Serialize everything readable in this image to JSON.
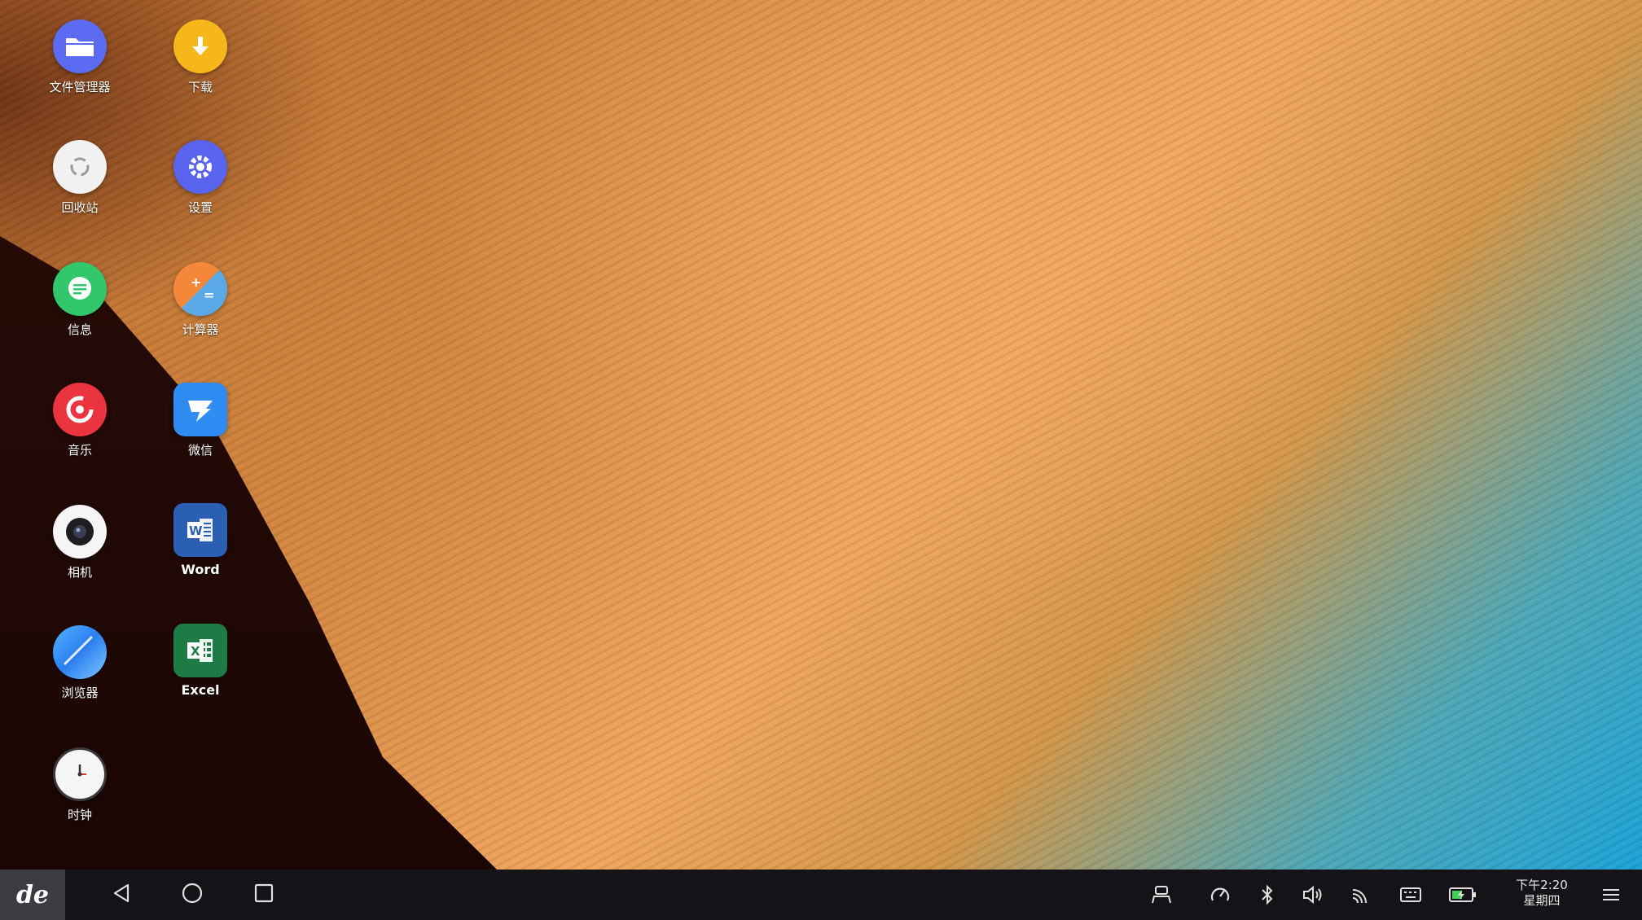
{
  "desktop": {
    "apps": [
      {
        "label": "文件管理器"
      },
      {
        "label": "下载"
      },
      {
        "label": "回收站"
      },
      {
        "label": "设置"
      },
      {
        "label": "信息"
      },
      {
        "label": "计算器"
      },
      {
        "label": "音乐"
      },
      {
        "label": "微信"
      },
      {
        "label": "相机"
      },
      {
        "label": "Word"
      },
      {
        "label": "浏览器"
      },
      {
        "label": "Excel"
      },
      {
        "label": "时钟"
      }
    ]
  },
  "taskbar": {
    "start_logo": "de",
    "clock": {
      "time": "下午2:20",
      "weekday": "星期四"
    },
    "tray_icons": [
      "user-icon",
      "speedometer-icon",
      "bluetooth-icon",
      "volume-icon",
      "wireless-icon",
      "keyboard-icon",
      "battery-icon",
      "menu-icon"
    ]
  },
  "colors": {
    "taskbar": "#161418",
    "start_button": "#3c3d42"
  }
}
